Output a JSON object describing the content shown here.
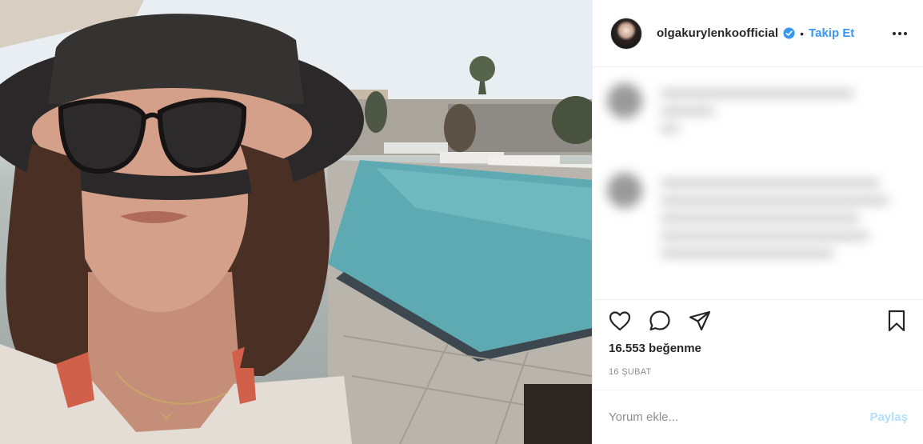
{
  "post": {
    "photo_label": "selfie-by-pool",
    "username": "olgakurylenkoofficial",
    "verified": true,
    "separator": "•",
    "follow_label": "Takip Et",
    "likes_text": "16.553 beğenme",
    "date_text": "16 ŞUBAT",
    "comment_placeholder": "Yorum ekle...",
    "post_label": "Paylaş"
  },
  "icons": {
    "more": "more-options-icon",
    "like": "heart-icon",
    "comment": "comment-bubble-icon",
    "share": "paper-plane-icon",
    "save": "bookmark-icon",
    "verified": "verified-badge-icon"
  },
  "colors": {
    "accent": "#3897f0",
    "post_disabled": "#b2dffc",
    "text": "#262626",
    "muted": "#8e8e8e",
    "border": "#efefef"
  }
}
